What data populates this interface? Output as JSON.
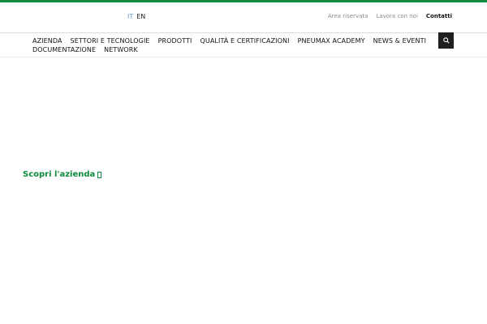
{
  "header": {
    "languages": [
      {
        "code": "IT",
        "active": true
      },
      {
        "code": "EN",
        "active": false
      }
    ],
    "utility_links": [
      {
        "label": "Area riservata"
      },
      {
        "label": "Lavora con noi"
      },
      {
        "label": "Contatti"
      }
    ],
    "search_icon": "search-icon"
  },
  "nav": {
    "row1": [
      "AZIENDA",
      "SETTORI E TECNOLOGIE",
      "PRODOTTI",
      "QUALITÀ E CERTIFICAZIONI",
      "PNEUMAX ACADEMY",
      "NEWS & EVENTI"
    ],
    "row2": [
      "DOCUMENTAZIONE",
      "NETWORK"
    ]
  },
  "hero": {
    "cta_label": "Scopri l'azienda"
  },
  "colors": {
    "brand_green": "#0e8a3d",
    "lang_active": "#5c9bd1",
    "muted_text": "#8a8a8a",
    "search_bg": "#1f1f1f"
  }
}
